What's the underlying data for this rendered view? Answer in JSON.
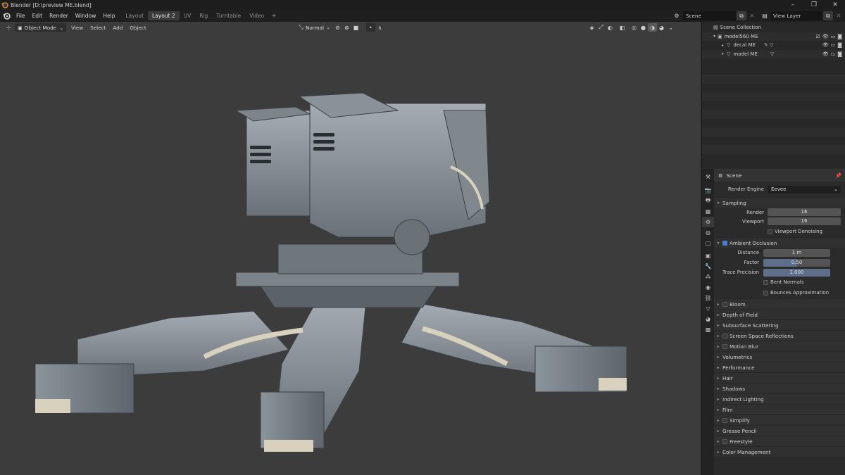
{
  "window": {
    "title": "Blender [D:\\preview ME.blend]"
  },
  "menus": [
    "File",
    "Edit",
    "Render",
    "Window",
    "Help"
  ],
  "workspaces": [
    "Layout",
    "Layout 2",
    "UV",
    "Rig",
    "Turntable",
    "Video"
  ],
  "active_workspace": "Layout 2",
  "scene_name": "Scene",
  "view_layer": "View Layer",
  "viewport": {
    "mode": "Object Mode",
    "menus": [
      "View",
      "Select",
      "Add",
      "Object"
    ],
    "orientation": "Normal"
  },
  "outliner": {
    "root": "Scene Collection",
    "items": [
      {
        "name": "model560 ME",
        "level": 1
      },
      {
        "name": "decal ME",
        "level": 2
      },
      {
        "name": "model ME",
        "level": 2
      }
    ]
  },
  "properties": {
    "context": "Scene",
    "render_engine_label": "Render Engine",
    "render_engine": "Eevee",
    "sampling": {
      "title": "Sampling",
      "render_label": "Render",
      "render": "16",
      "viewport_label": "Viewport",
      "viewport": "16",
      "denoise_label": "Viewport Denoising"
    },
    "ao": {
      "title": "Ambient Occlusion",
      "distance_label": "Distance",
      "distance": "1 m",
      "factor_label": "Factor",
      "factor": "0.50",
      "trace_label": "Trace Precision",
      "trace": "1.000",
      "bent_label": "Bent Normals",
      "bounces_label": "Bounces Approximation"
    },
    "panels": [
      {
        "label": "Bloom",
        "checkbox": true
      },
      {
        "label": "Depth of Field",
        "checkbox": false
      },
      {
        "label": "Subsurface Scattering",
        "checkbox": false
      },
      {
        "label": "Screen Space Reflections",
        "checkbox": true
      },
      {
        "label": "Motion Blur",
        "checkbox": true
      },
      {
        "label": "Volumetrics",
        "checkbox": false
      },
      {
        "label": "Performance",
        "checkbox": false
      },
      {
        "label": "Hair",
        "checkbox": false
      },
      {
        "label": "Shadows",
        "checkbox": false
      },
      {
        "label": "Indirect Lighting",
        "checkbox": false
      },
      {
        "label": "Film",
        "checkbox": false
      },
      {
        "label": "Simplify",
        "checkbox": true
      },
      {
        "label": "Grease Pencil",
        "checkbox": false
      },
      {
        "label": "Freestyle",
        "checkbox": true
      },
      {
        "label": "Color Management",
        "checkbox": false
      }
    ]
  },
  "colors": {
    "accent": "#4a7bd0",
    "orange": "#e08a2c"
  }
}
